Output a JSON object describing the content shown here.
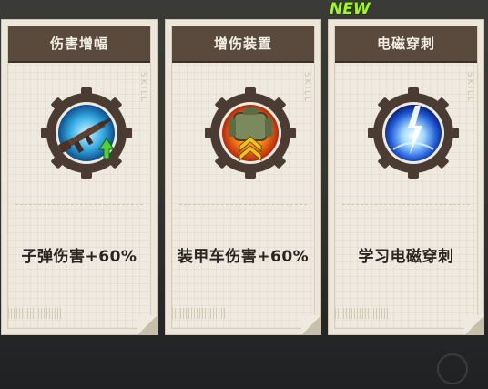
{
  "badge": {
    "new_label": "NEW"
  },
  "cards": [
    {
      "title": "伤害增幅",
      "description": "子弹伤害+60%",
      "skill_tag": "SKILL",
      "icon": "rifle-upgrade-icon"
    },
    {
      "title": "增伤装置",
      "description": "装甲车伤害+60%",
      "skill_tag": "SKILL",
      "icon": "armor-boost-icon"
    },
    {
      "title": "电磁穿刺",
      "description": "学习电磁穿刺",
      "skill_tag": "SKILL",
      "icon": "electro-pierce-icon"
    }
  ],
  "colors": {
    "header": "#5a4a3e",
    "card_bg": "#efeadf",
    "new_badge": "#a7f02a",
    "gear": "#4a3c32"
  }
}
